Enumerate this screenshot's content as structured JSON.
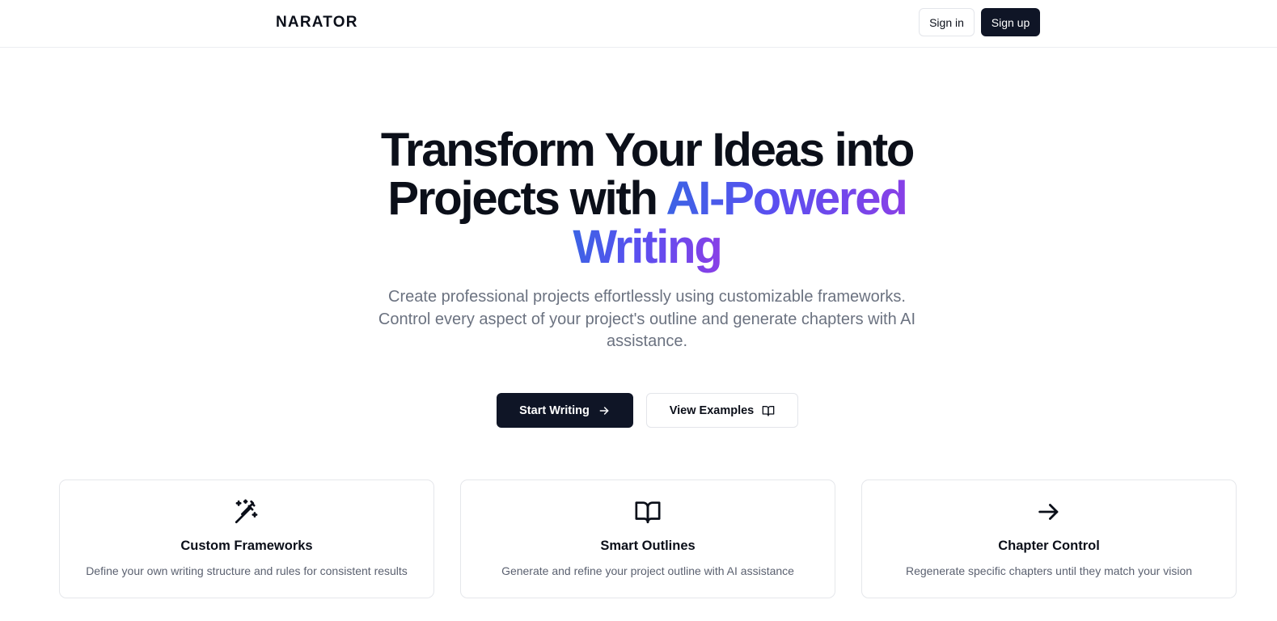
{
  "header": {
    "logo": "NARATOR",
    "sign_in_label": "Sign in",
    "sign_up_label": "Sign up"
  },
  "hero": {
    "title_line1": "Transform Your Ideas into",
    "title_line2_plain": "Projects with ",
    "title_line2_gradient": "AI-Powered",
    "title_line3_gradient": "Writing",
    "subtitle": "Create professional projects effortlessly using customizable frameworks. Control every aspect of your project's outline and generate chapters with AI assistance.",
    "primary_cta": {
      "label": "Start Writing",
      "icon": "arrow-right-icon"
    },
    "secondary_cta": {
      "label": "View Examples",
      "icon": "book-open-icon"
    }
  },
  "features": [
    {
      "icon": "magic-wand-icon",
      "title": "Custom Frameworks",
      "description": "Define your own writing structure and rules for consistent results"
    },
    {
      "icon": "book-open-icon",
      "title": "Smart Outlines",
      "description": "Generate and refine your project outline with AI assistance"
    },
    {
      "icon": "arrow-right-icon",
      "title": "Chapter Control",
      "description": "Regenerate specific chapters until they match your vision"
    }
  ],
  "colors": {
    "primary": "#0f1526",
    "gradient_start": "#3b64e4",
    "gradient_end": "#8a3fe6",
    "muted_text": "#6b7280"
  }
}
